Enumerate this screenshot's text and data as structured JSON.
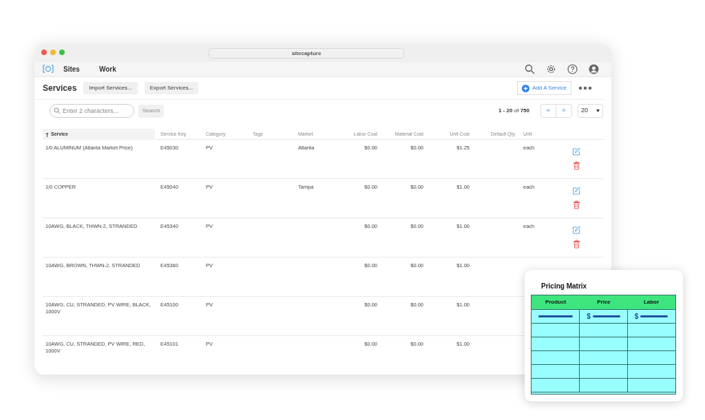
{
  "window": {
    "title": "sitecapture"
  },
  "nav": {
    "items": [
      {
        "label": "Sites",
        "selected": false
      },
      {
        "label": "Work",
        "selected": false
      }
    ]
  },
  "page": {
    "title": "Services",
    "buttons": [
      "Import Services...",
      "Export Services..."
    ],
    "add_button": "Add A Service"
  },
  "search": {
    "placeholder": "Enter 2 characters...",
    "button": "Search"
  },
  "pagination": {
    "summary": "**1 - 20** of **750**",
    "prev": "«",
    "next": "»",
    "page_size": "20"
  },
  "table": {
    "columns": [
      {
        "label": "Service",
        "sorted": true
      },
      {
        "label": "Service Key",
        "sorted": false
      },
      {
        "label": "Category",
        "sorted": false
      },
      {
        "label": "Tags",
        "sorted": false
      },
      {
        "label": "Market",
        "sorted": false
      },
      {
        "label": "Labor Cost",
        "sorted": false
      },
      {
        "label": "Material Cost",
        "sorted": false
      },
      {
        "label": "Unit Cost",
        "sorted": false
      },
      {
        "label": "Default Qty",
        "sorted": false
      },
      {
        "label": "Unit",
        "sorted": false
      }
    ],
    "rows": [
      {
        "cells": [
          "1/0 ALUMINUM (Atlanta Market Price)",
          "E45030",
          "PV",
          "",
          "Atlanta",
          "$0.00",
          "$0.00",
          "$1.25",
          "",
          "each"
        ],
        "actions": [
          {
            "kind": "edit"
          },
          {
            "kind": "delete"
          }
        ]
      },
      {
        "cells": [
          "1/0 COPPER",
          "E45040",
          "PV",
          "",
          "Tampa",
          "$0.00",
          "$0.00",
          "$1.00",
          "",
          "each"
        ],
        "actions": [
          {
            "kind": "edit"
          },
          {
            "kind": "delete"
          }
        ]
      },
      {
        "cells": [
          "10AWG, BLACK, THWN-2, STRANDED",
          "E45340",
          "PV",
          "",
          "",
          "$0.00",
          "$0.00",
          "$1.00",
          "",
          "each"
        ],
        "actions": [
          {
            "kind": "edit"
          },
          {
            "kind": "delete"
          }
        ]
      },
      {
        "cells": [
          "10AWG, BROWN, THWN-2, STRANDED",
          "E45360",
          "PV",
          "",
          "",
          "$0.00",
          "$0.00",
          "$1.00",
          "",
          ""
        ],
        "actions": []
      },
      {
        "cells": [
          "10AWG, CU, STRANDED, PV WIRE, BLACK, 1000V",
          "E45100",
          "PV",
          "",
          "",
          "$0.00",
          "$0.00",
          "$1.00",
          "",
          ""
        ],
        "actions": []
      },
      {
        "cells": [
          "10AWG, CU, STRANDED, PV WIRE, RED, 1000V",
          "E45101",
          "PV",
          "",
          "",
          "$0.00",
          "$0.00",
          "$1.00",
          "",
          ""
        ],
        "actions": []
      }
    ]
  },
  "pricing_matrix": {
    "title": "Pricing Matrix",
    "columns": [
      "Product",
      "Price",
      "Labor"
    ],
    "rows": [
      {
        "cells": [
          {
            "kind": "line"
          },
          {
            "kind": "money",
            "symbol": "$"
          },
          {
            "kind": "money",
            "symbol": "$"
          }
        ]
      },
      {
        "cells": [
          {
            "kind": "blank"
          },
          {
            "kind": "blank"
          },
          {
            "kind": "blank"
          }
        ]
      },
      {
        "cells": [
          {
            "kind": "blank"
          },
          {
            "kind": "blank"
          },
          {
            "kind": "blank"
          }
        ]
      },
      {
        "cells": [
          {
            "kind": "blank"
          },
          {
            "kind": "blank"
          },
          {
            "kind": "blank"
          }
        ]
      },
      {
        "cells": [
          {
            "kind": "blank"
          },
          {
            "kind": "blank"
          },
          {
            "kind": "blank"
          }
        ]
      },
      {
        "cells": [
          {
            "kind": "blank"
          },
          {
            "kind": "blank"
          },
          {
            "kind": "blank"
          }
        ]
      }
    ]
  }
}
